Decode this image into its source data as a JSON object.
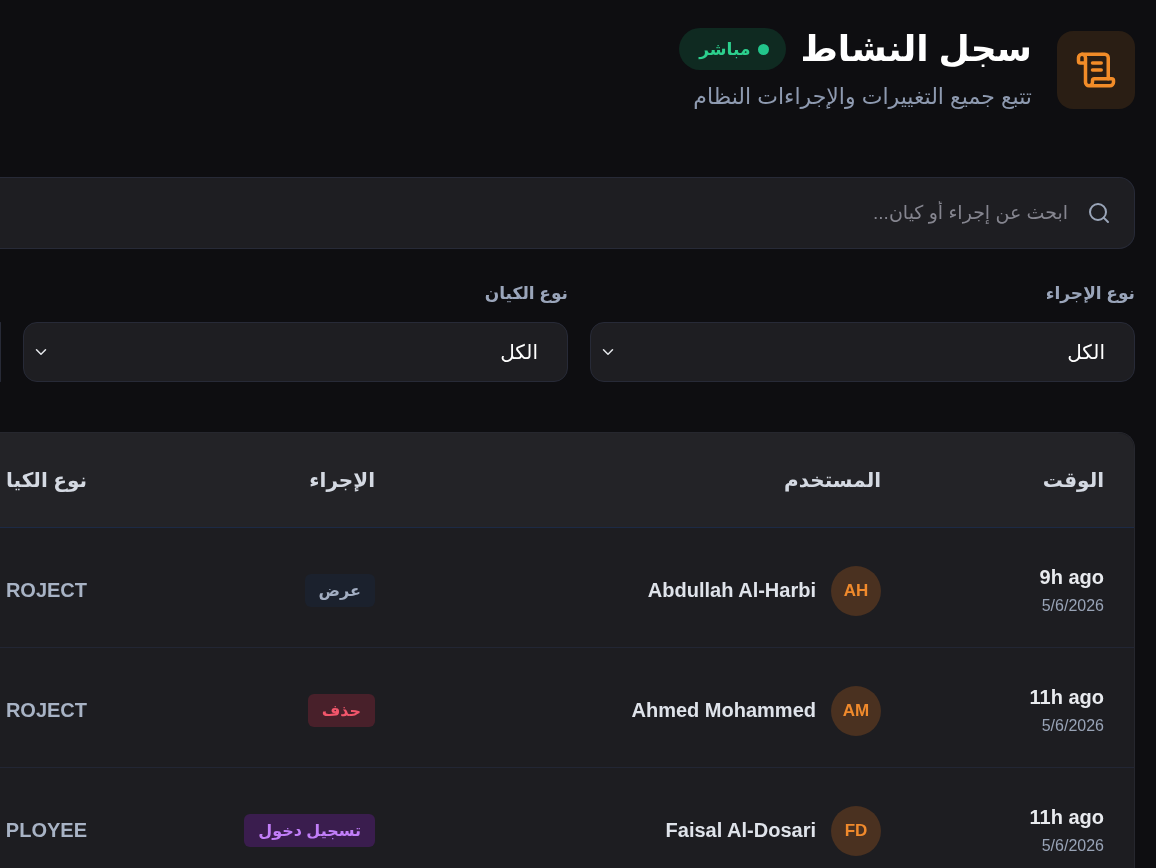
{
  "header": {
    "title": "سجل النشاط",
    "status_badge": "مباشر",
    "subtitle": "تتبع جميع التغييرات والإجراءات النظام"
  },
  "search": {
    "placeholder": "ابحث عن إجراء أو كيان..."
  },
  "filters": [
    {
      "label": "نوع الإجراء",
      "value": "الكل"
    },
    {
      "label": "نوع الكيان",
      "value": "الكل"
    }
  ],
  "table": {
    "columns": [
      "الوقت",
      "المستخدم",
      "الإجراء",
      "نوع الكيا"
    ],
    "rows": [
      {
        "time": "9h ago",
        "date": "5/6/2026",
        "user": {
          "initials": "AH",
          "name": "Abdullah Al-Harbi"
        },
        "action": {
          "kind": "view",
          "label": "عرض"
        },
        "entity_type": "ROJECT"
      },
      {
        "time": "11h ago",
        "date": "5/6/2026",
        "user": {
          "initials": "AM",
          "name": "Ahmed Mohammed"
        },
        "action": {
          "kind": "delete",
          "label": "حذف"
        },
        "entity_type": "ROJECT"
      },
      {
        "time": "11h ago",
        "date": "5/6/2026",
        "user": {
          "initials": "FD",
          "name": "Faisal Al-Dosari"
        },
        "action": {
          "kind": "login",
          "label": "تسجيل دخول"
        },
        "entity_type": "PLOYEE"
      }
    ]
  }
}
